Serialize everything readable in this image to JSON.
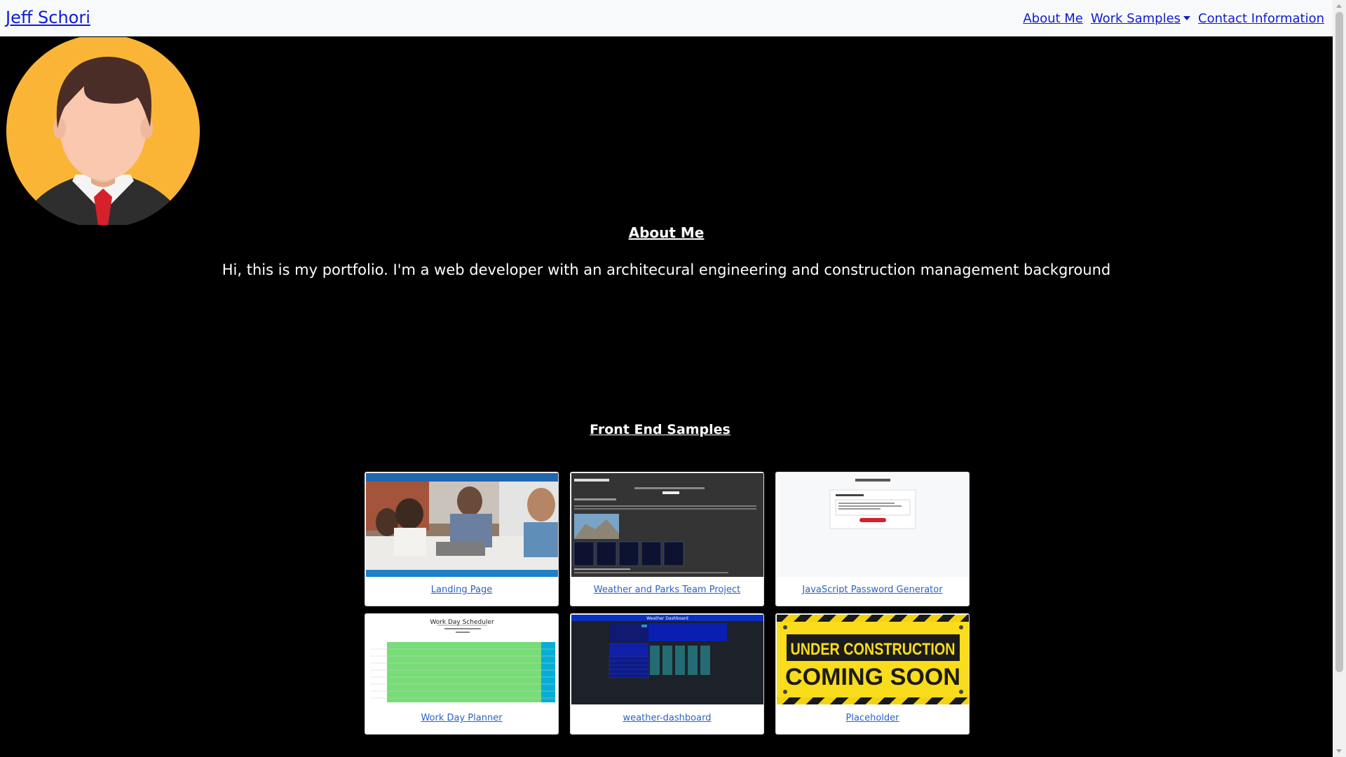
{
  "nav": {
    "brand": "Jeff Schori",
    "links": [
      {
        "label": "About Me"
      },
      {
        "label": "Work Samples"
      },
      {
        "label": "Contact Information"
      }
    ]
  },
  "about": {
    "title": "About Me",
    "text": "Hi, this is my portfolio. I'm a web developer with an architecural engineering and construction management background"
  },
  "samples": {
    "title": "Front End Samples",
    "cards": [
      {
        "label": "Landing Page"
      },
      {
        "label": "Weather and Parks Team Project"
      },
      {
        "label": "JavaScript Password Generator"
      },
      {
        "label": "Work Day Planner"
      },
      {
        "label": "weather-dashboard"
      },
      {
        "label": "Placeholder"
      }
    ]
  },
  "thumbnails": {
    "scheduler_title": "Work Day Scheduler",
    "weather_title": "Weather Dashboard",
    "construction_line1": "UNDER CONSTRUCTION",
    "construction_line2": "COMING SOON"
  },
  "colors": {
    "background": "#000000",
    "navbar": "#f8f9fa",
    "link": "#0d1bd6",
    "card_link": "#2a63c9",
    "avatar_bg": "#fbb536"
  }
}
